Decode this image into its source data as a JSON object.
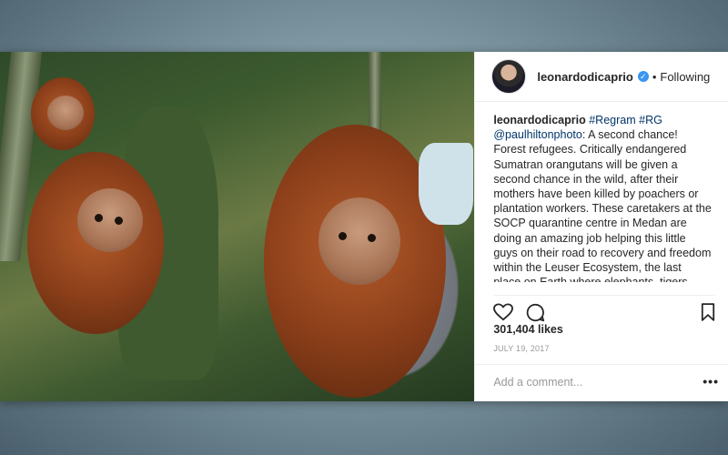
{
  "post": {
    "username": "leonardodicaprio",
    "separator": "•",
    "following_label": "Following",
    "caption": {
      "username": "leonardodicaprio",
      "tag1": "#Regram",
      "tag2": "#RG",
      "mention": "@paulhiltonphoto",
      "text": ": A second chance! Forest refugees. Critically endangered Sumatran orangutans will be given a second chance in the wild, after their mothers have been killed by poachers or plantation workers. These caretakers at the SOCP quarantine centre in Medan are doing an amazing job helping this little guys on their road to recovery and freedom within the Leuser Ecosystem, the last place on Earth where elephants, tigers,"
    },
    "likes": "301,404 likes",
    "date": "JULY 19, 2017",
    "comment_placeholder": "Add a comment...",
    "more_label": "•••"
  },
  "icons": {
    "verified": "verified-badge-icon",
    "like": "heart-icon",
    "comment": "comment-bubble-icon",
    "save": "bookmark-icon",
    "more": "more-options-icon"
  },
  "colors": {
    "verified_blue": "#3897f0",
    "hashtag": "#003569",
    "text": "#262626",
    "muted": "#999999"
  }
}
